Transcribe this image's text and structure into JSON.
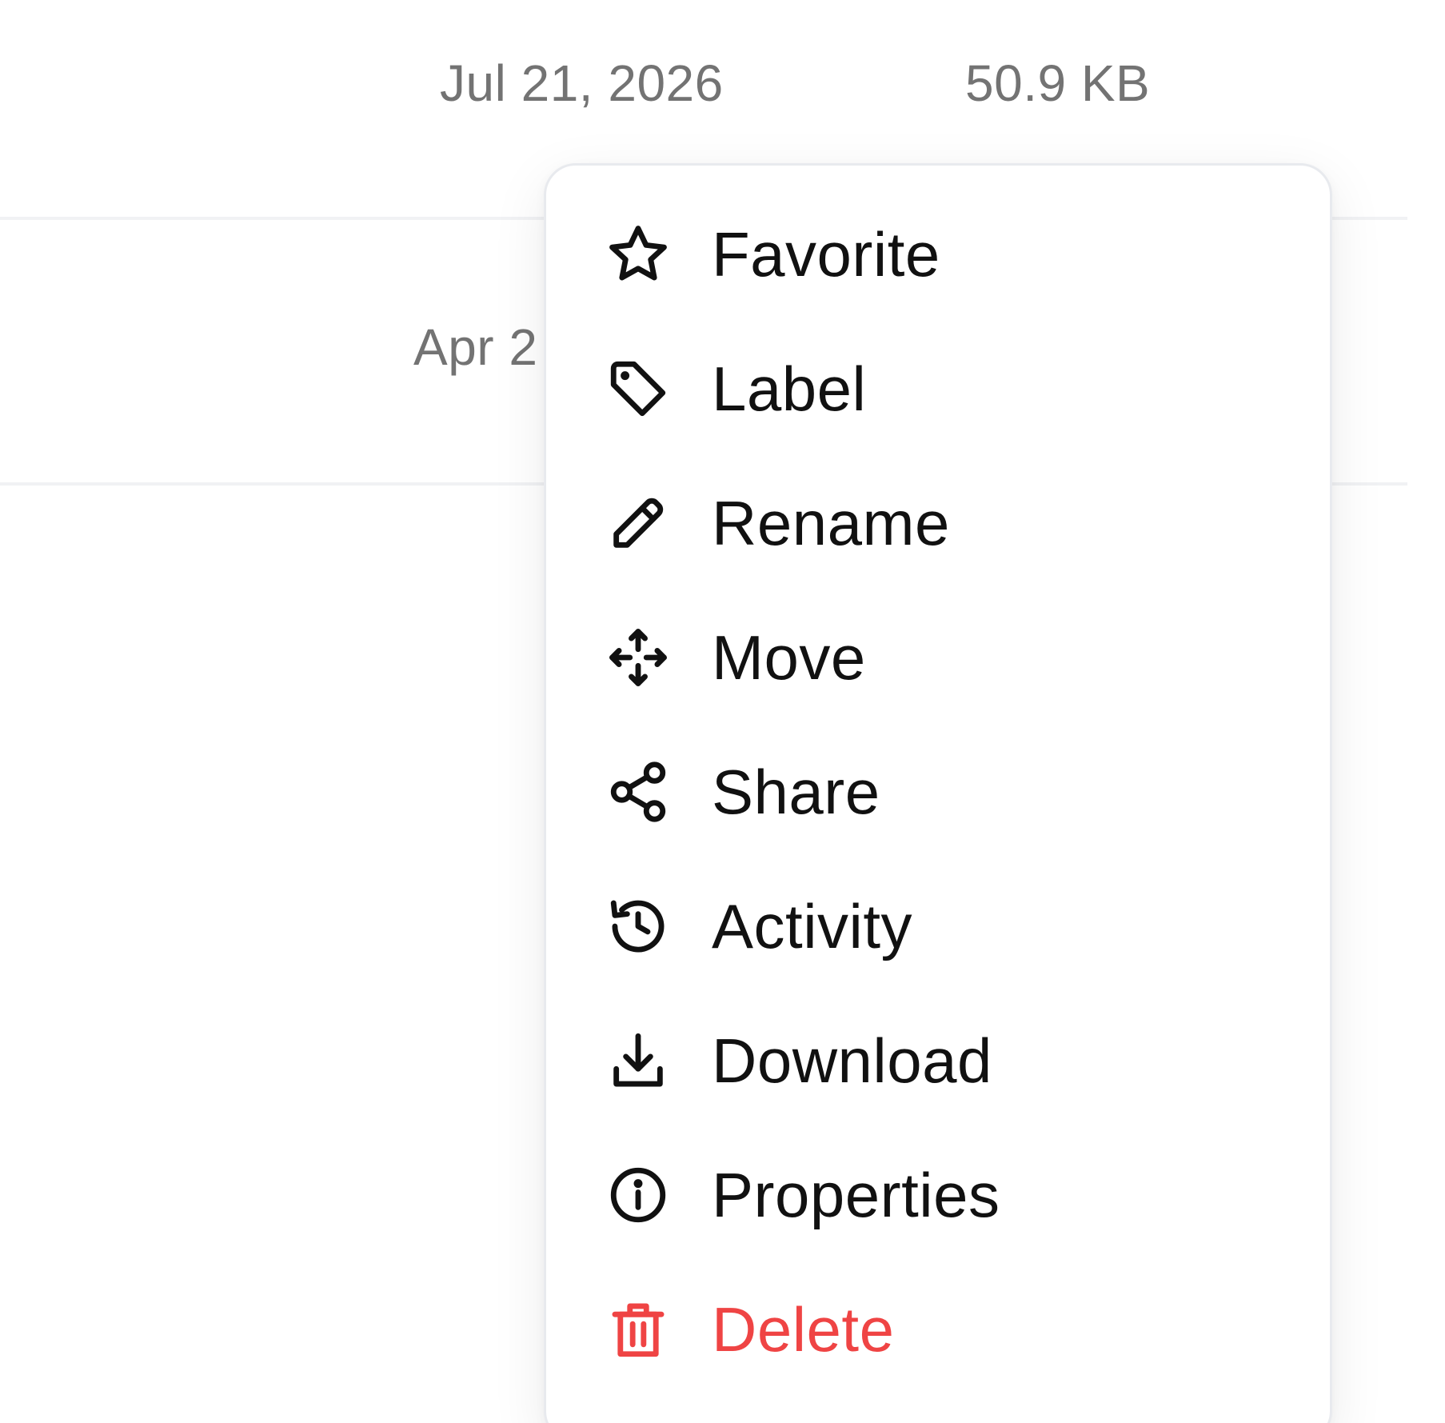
{
  "file_list": {
    "rows": [
      {
        "date": "Jul 21, 2026",
        "size": "50.9 KB"
      },
      {
        "date": "Apr 2",
        "size": ""
      }
    ]
  },
  "context_menu": {
    "items": [
      {
        "label": "Favorite",
        "icon": "star-icon"
      },
      {
        "label": "Label",
        "icon": "tag-icon"
      },
      {
        "label": "Rename",
        "icon": "pencil-icon"
      },
      {
        "label": "Move",
        "icon": "move-arrows-icon"
      },
      {
        "label": "Share",
        "icon": "share-icon"
      },
      {
        "label": "Activity",
        "icon": "history-icon"
      },
      {
        "label": "Download",
        "icon": "download-icon"
      },
      {
        "label": "Properties",
        "icon": "info-icon"
      },
      {
        "label": "Delete",
        "icon": "trash-icon",
        "color": "#ef4444"
      }
    ]
  },
  "colors": {
    "text_primary": "#111111",
    "text_muted": "#737373",
    "danger": "#ef4444",
    "border": "#e8eaee"
  }
}
